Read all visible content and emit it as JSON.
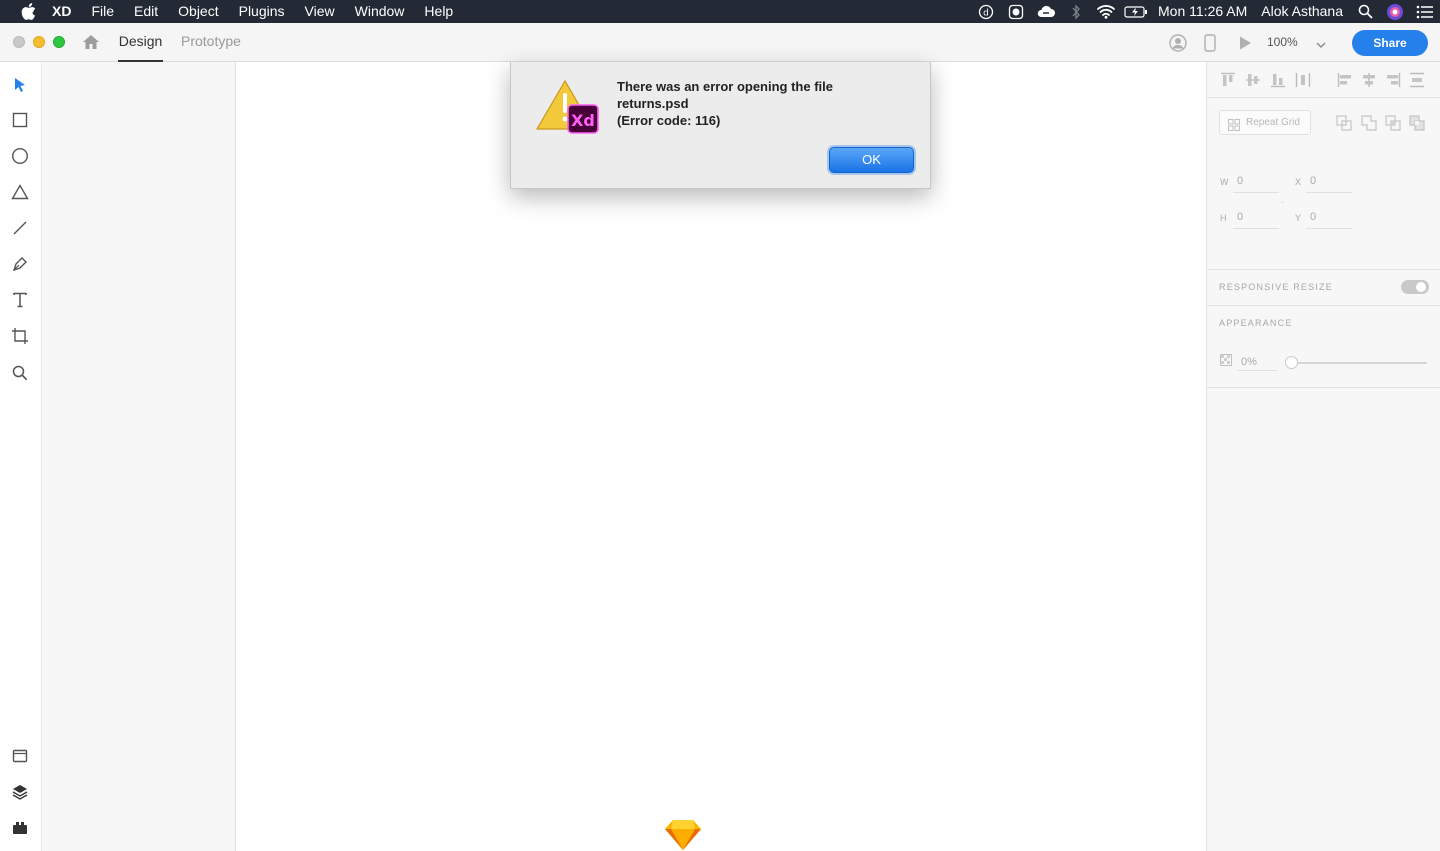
{
  "menubar": {
    "app_name": "XD",
    "items": [
      "File",
      "Edit",
      "Object",
      "Plugins",
      "View",
      "Window",
      "Help"
    ],
    "status_icons": [
      "creative-cloud-icon",
      "fantastical-icon",
      "cloud-icon",
      "bluetooth-icon",
      "wifi-icon",
      "battery-icon"
    ],
    "clock": "Mon 11:26 AM",
    "user": "Alok Asthana"
  },
  "toolbar": {
    "tab_design": "Design",
    "tab_prototype": "Prototype",
    "zoom": "100%",
    "share_label": "Share"
  },
  "left_tools": [
    "select-tool",
    "rectangle-tool",
    "ellipse-tool",
    "polygon-tool",
    "line-tool",
    "pen-tool",
    "text-tool",
    "artboard-tool",
    "zoom-tool"
  ],
  "left_bottom_tools": [
    "assets-icon",
    "layers-icon",
    "plugins-icon"
  ],
  "inspector": {
    "repeat_grid": "Repeat Grid",
    "w_label": "W",
    "w_value": "0",
    "h_label": "H",
    "h_value": "0",
    "x_label": "X",
    "x_value": "0",
    "y_label": "Y",
    "y_value": "0",
    "responsive_resize": "RESPONSIVE RESIZE",
    "appearance": "APPEARANCE",
    "opacity": "0%"
  },
  "dialog": {
    "line1": "There was an error opening the file",
    "line2": "returns.psd",
    "line3": "(Error code: 116)",
    "ok_label": "OK",
    "icon_badge": "Xd"
  },
  "colors": {
    "menubar_bg": "#232a35",
    "accent": "#2680eb",
    "xd_brand": "#470137",
    "xd_pink": "#ff61f6"
  }
}
